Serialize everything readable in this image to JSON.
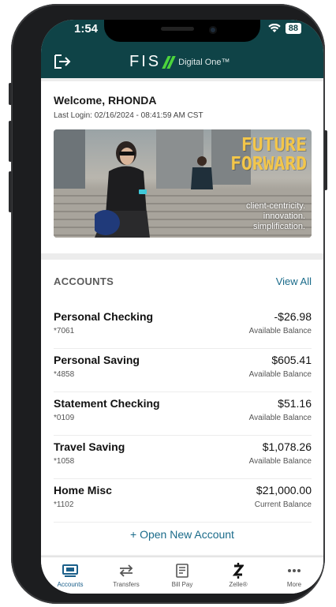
{
  "status": {
    "time": "1:54",
    "battery": "88"
  },
  "header": {
    "brand": "FIS",
    "product": "Digital One™"
  },
  "welcome": {
    "title": "Welcome, RHONDA",
    "last_login": "Last Login: 02/16/2024 - 08:41:59 AM CST"
  },
  "banner": {
    "headline_1": "FUTURE",
    "headline_2": "FORWARD",
    "tagline_1": "client-centricity.",
    "tagline_2": "innovation.",
    "tagline_3": "simplification."
  },
  "accounts": {
    "heading": "ACCOUNTS",
    "view_all": "View All",
    "items": [
      {
        "name": "Personal Checking",
        "number": "*7061",
        "amount": "-$26.98",
        "balance_type": "Available Balance"
      },
      {
        "name": "Personal Saving",
        "number": "*4858",
        "amount": "$605.41",
        "balance_type": "Available Balance"
      },
      {
        "name": "Statement Checking",
        "number": "*0109",
        "amount": "$51.16",
        "balance_type": "Available Balance"
      },
      {
        "name": "Travel Saving",
        "number": "*1058",
        "amount": "$1,078.26",
        "balance_type": "Available Balance"
      },
      {
        "name": "Home Misc",
        "number": "*1102",
        "amount": "$21,000.00",
        "balance_type": "Current Balance"
      }
    ],
    "open_new": "+ Open New Account"
  },
  "tabs": [
    {
      "label": "Accounts",
      "icon": "accounts-icon",
      "active": true
    },
    {
      "label": "Transfers",
      "icon": "transfers-icon",
      "active": false
    },
    {
      "label": "Bill Pay",
      "icon": "bill-pay-icon",
      "active": false
    },
    {
      "label": "Zelle®",
      "icon": "zelle-icon",
      "active": false
    },
    {
      "label": "More",
      "icon": "more-icon",
      "active": false
    }
  ],
  "colors": {
    "header": "#0f4347",
    "accent": "#1a6b8a",
    "brand_green": "#4cd43c",
    "banner_text": "#f3c64a"
  }
}
